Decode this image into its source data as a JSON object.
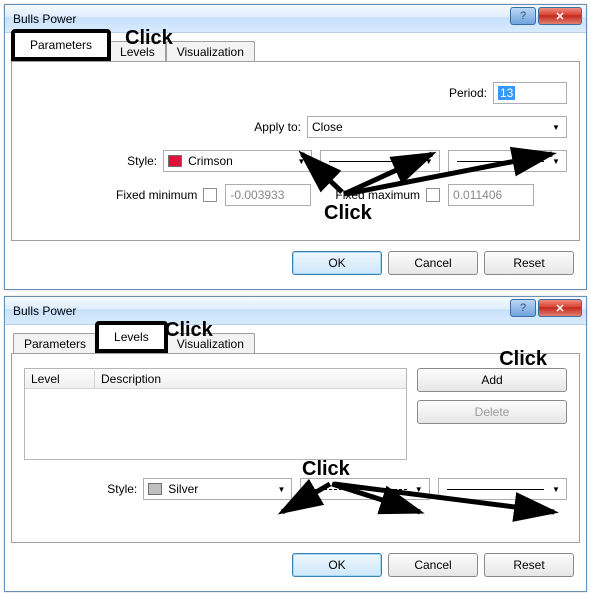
{
  "window1": {
    "title": "Bulls Power",
    "tabs": {
      "parameters": "Parameters",
      "levels": "Levels",
      "visualization": "Visualization"
    },
    "labels": {
      "period": "Period:",
      "apply_to": "Apply to:",
      "style": "Style:",
      "fixed_min": "Fixed minimum",
      "fixed_max": "Fixed maximum"
    },
    "values": {
      "period": "13",
      "apply_to": "Close",
      "style_color_name": "Crimson",
      "style_color_hex": "#dc143c",
      "fixed_min": "-0.003933",
      "fixed_max": "0.011406"
    },
    "buttons": {
      "ok": "OK",
      "cancel": "Cancel",
      "reset": "Reset"
    }
  },
  "window2": {
    "title": "Bulls Power",
    "tabs": {
      "parameters": "Parameters",
      "levels": "Levels",
      "visualization": "Visualization"
    },
    "labels": {
      "style": "Style:"
    },
    "table": {
      "col_level": "Level",
      "col_desc": "Description"
    },
    "values": {
      "style_color_name": "Silver",
      "style_color_hex": "#c0c0c0"
    },
    "buttons": {
      "add": "Add",
      "delete": "Delete",
      "ok": "OK",
      "cancel": "Cancel",
      "reset": "Reset"
    }
  },
  "annotations": {
    "click": "Click"
  }
}
